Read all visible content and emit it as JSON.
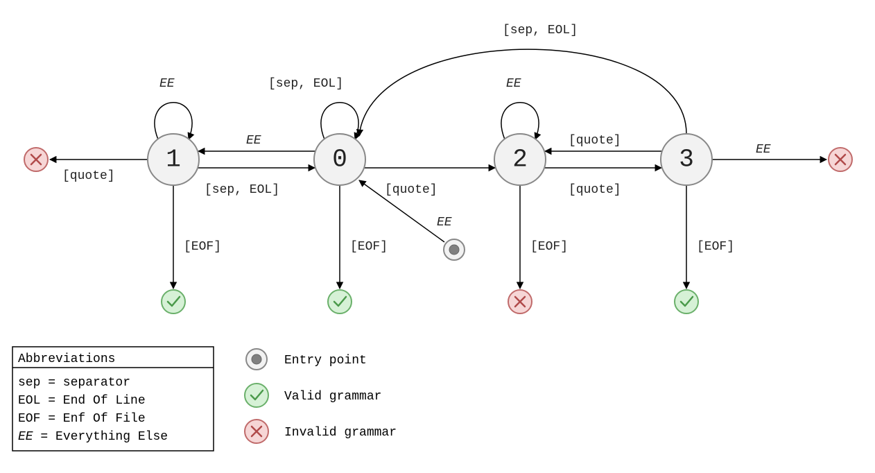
{
  "states": {
    "s0": "0",
    "s1": "1",
    "s2": "2",
    "s3": "3"
  },
  "edge_labels": {
    "ee": "EE",
    "sep_eol": "[sep, EOL]",
    "quote": "[quote]",
    "eof": "[EOF]"
  },
  "legend": {
    "title": "Abbreviations",
    "rows": [
      "sep = separator",
      "EOL = End Of Line",
      "EOF = Enf Of File",
      "EE  = Everything Else"
    ],
    "entry": "Entry point",
    "valid": "Valid grammar",
    "invalid": "Invalid grammar"
  }
}
